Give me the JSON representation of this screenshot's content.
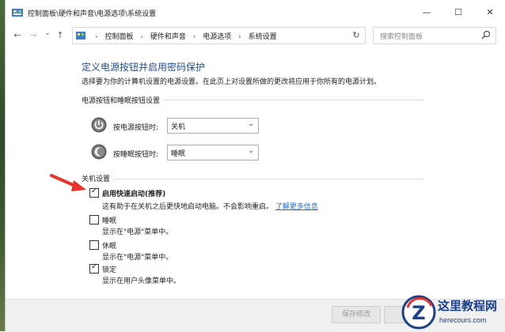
{
  "window": {
    "title": "控制面板\\硬件和声音\\电源选项\\系统设置",
    "minimize": "—",
    "maximize": "☐",
    "close": "✕"
  },
  "nav": {
    "back": "←",
    "forward": "→",
    "dropdown": "⌄",
    "up": "↑",
    "breadcrumbs": [
      "控制面板",
      "硬件和声音",
      "电源选项",
      "系统设置"
    ],
    "separator": "›",
    "address_dropdown": "⌄",
    "refresh": "↻",
    "search_placeholder": "搜索控制面板"
  },
  "page": {
    "heading": "定义电源按钮并启用密码保护",
    "description": "选择要为你的计算机设置的电源设置。在此页上对设置所做的更改将应用于你所有的电源计划。"
  },
  "power_buttons": {
    "group_label": "电源按钮和睡眠按钮设置",
    "power_button": {
      "label": "按电源按钮时:",
      "value": "关机",
      "caret": "⌄"
    },
    "sleep_button": {
      "label": "按睡眠按钮时:",
      "value": "睡眠",
      "caret": "⌄"
    }
  },
  "shutdown": {
    "group_label": "关机设置",
    "items": [
      {
        "label": "启用快速启动(推荐)",
        "checked": true,
        "bold": true,
        "desc": "这有助于在关机之后更快地启动电脑。不会影响重启。",
        "link": "了解更多信息"
      },
      {
        "label": "睡眠",
        "checked": false,
        "desc": "显示在\"电源\"菜单中。"
      },
      {
        "label": "休眠",
        "checked": false,
        "desc": "显示在\"电源\"菜单中。"
      },
      {
        "label": "锁定",
        "checked": true,
        "desc": "显示在用户头像菜单中。"
      }
    ],
    "check_glyph": "✓"
  },
  "footer": {
    "save_label": "保存修改"
  },
  "watermark": {
    "name": "这里教程网",
    "url": "herecours.com",
    "letter": "Z"
  },
  "colors": {
    "heading": "#1e4e9a",
    "link": "#1e6fd0",
    "arrow": "#e8332b"
  }
}
